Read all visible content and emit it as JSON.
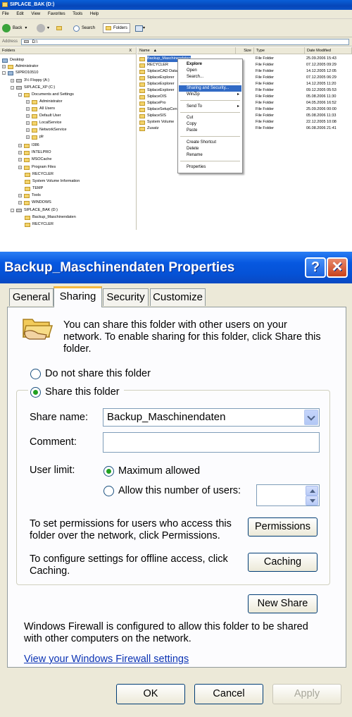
{
  "explorer": {
    "title": "SIPLACE_BAK (D:)",
    "menu": [
      "File",
      "Edit",
      "View",
      "Favorites",
      "Tools",
      "Help"
    ],
    "toolbar": {
      "back": "Back",
      "search": "Search",
      "folders": "Folders"
    },
    "address_label": "Address",
    "address_value": "D:\\",
    "tree_header": "Folders",
    "tree_close": "X",
    "tree": [
      "Desktop",
      "Administrator",
      "SIPRO10510",
      "3½ Floppy (A:)",
      "SIPLACE_XP (C:)",
      "Documents and Settings",
      "Administrator",
      "All Users",
      "Default User",
      "LocalService",
      "NetworkService",
      "plr",
      "I386",
      "INTELPRO",
      "MSOCache",
      "Program Files",
      "RECYCLER",
      "System Volume Information",
      "TEMP",
      "Tools",
      "WINDOWS",
      "SIPLACE_BAK (D:)",
      "Backup_Maschinendaten",
      "RECYCLER"
    ],
    "columns": {
      "name": "Name",
      "size": "Size",
      "type": "Type",
      "date": "Date Modified"
    },
    "files": [
      {
        "name": "Backup_Maschinendaten",
        "type": "File Folder",
        "date": "25.09.2006 15:43"
      },
      {
        "name": "RECYCLER",
        "type": "File Folder",
        "date": "07.12.2005 09:29"
      },
      {
        "name": "SiplaceCAD Data",
        "type": "File Folder",
        "date": "14.12.2005 12:05"
      },
      {
        "name": "SiplaceExplorer",
        "type": "File Folder",
        "date": "07.12.2005 06:29"
      },
      {
        "name": "SiplaceExplorer",
        "type": "File Folder",
        "date": "14.12.2005 11:20"
      },
      {
        "name": "SiplaceExplorer",
        "type": "File Folder",
        "date": "09.12.2005 05:53"
      },
      {
        "name": "SiplaceOIS",
        "type": "File Folder",
        "date": "05.08.2006 11:30"
      },
      {
        "name": "SiplacePro",
        "type": "File Folder",
        "date": "04.05.2006 16:52"
      },
      {
        "name": "SiplaceSetupCen",
        "type": "File Folder",
        "date": "25.09.2006 00:00"
      },
      {
        "name": "SiplaceSIS",
        "type": "File Folder",
        "date": "05.08.2006 11:33"
      },
      {
        "name": "System Volume",
        "type": "File Folder",
        "date": "22.12.2005 10:08"
      },
      {
        "name": "Zusatz",
        "type": "File Folder",
        "date": "06.08.2006 21:41"
      }
    ],
    "context_menu": {
      "explore": "Explore",
      "open": "Open",
      "search": "Search...",
      "sharing": "Sharing and Security...",
      "winzip": "WinZip",
      "send_to": "Send To",
      "cut": "Cut",
      "copy": "Copy",
      "paste": "Paste",
      "create_shortcut": "Create Shortcut",
      "delete": "Delete",
      "rename": "Rename",
      "properties": "Properties"
    }
  },
  "dialog": {
    "title": "Backup_Maschinendaten Properties",
    "help_btn": "?",
    "close_btn": "✕",
    "tabs": [
      "General",
      "Sharing",
      "Security",
      "Customize"
    ],
    "active_tab": "Sharing",
    "intro_line1": "You can share this folder with other users on your",
    "intro_line2": "network.  To enable sharing for this folder, click Share this",
    "intro_line3": "folder.",
    "radio_no_share": "Do not share this folder",
    "radio_share": "Share this folder",
    "share_name_label": "Share name:",
    "share_name_value": "Backup_Maschinendaten",
    "comment_label": "Comment:",
    "comment_value": "",
    "user_limit_label": "User limit:",
    "max_allowed": "Maximum allowed",
    "allow_number": "Allow this number of users:",
    "perm_text1": "To set permissions for users who access this",
    "perm_text2": "folder over the network, click Permissions.",
    "permissions_btn": "Permissions",
    "cache_text1": "To configure settings for offline access, click",
    "cache_text2": "Caching.",
    "caching_btn": "Caching",
    "new_share_btn": "New Share",
    "firewall_text1": "Windows Firewall is configured to allow this folder to be shared",
    "firewall_text2": "with other computers on the network.",
    "firewall_link": "View your Windows Firewall settings",
    "ok_btn": "OK",
    "cancel_btn": "Cancel",
    "apply_btn": "Apply"
  }
}
